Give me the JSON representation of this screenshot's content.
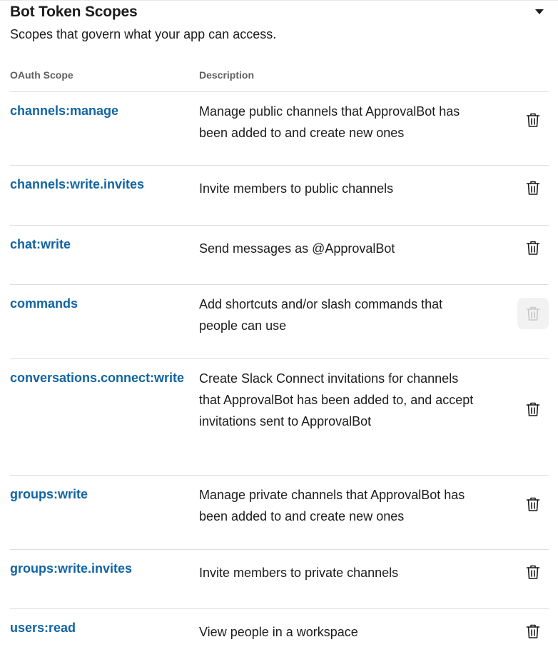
{
  "section": {
    "title": "Bot Token Scopes",
    "subtitle": "Scopes that govern what your app can access.",
    "toggle_icon": "caret-down-icon"
  },
  "table": {
    "headers": {
      "scope": "OAuth Scope",
      "description": "Description"
    },
    "rows": [
      {
        "scope": "channels:manage",
        "description": "Manage public channels that ApprovalBot has been added to and create new ones",
        "delete_disabled": false
      },
      {
        "scope": "channels:write.invites",
        "description": "Invite members to public channels",
        "delete_disabled": false
      },
      {
        "scope": "chat:write",
        "description": "Send messages as @ApprovalBot",
        "delete_disabled": false
      },
      {
        "scope": "commands",
        "description": "Add shortcuts and/or slash commands that people can use",
        "delete_disabled": true
      },
      {
        "scope": "conversations.connect:write",
        "description": "Create Slack Connect invitations for channels that ApprovalBot has been added to, and accept invitations sent to ApprovalBot",
        "delete_disabled": false
      },
      {
        "scope": "groups:write",
        "description": "Manage private channels that ApprovalBot has been added to and create new ones",
        "delete_disabled": false
      },
      {
        "scope": "groups:write.invites",
        "description": "Invite members to private channels",
        "delete_disabled": false
      },
      {
        "scope": "users:read",
        "description": "View people in a workspace",
        "delete_disabled": false
      }
    ]
  },
  "colors": {
    "link": "#1264a3",
    "text": "#1d1c1d",
    "muted": "#616061",
    "divider": "#dddddd",
    "disabled_bg": "#f2f2f2"
  },
  "icons": {
    "delete": "trash-icon"
  }
}
